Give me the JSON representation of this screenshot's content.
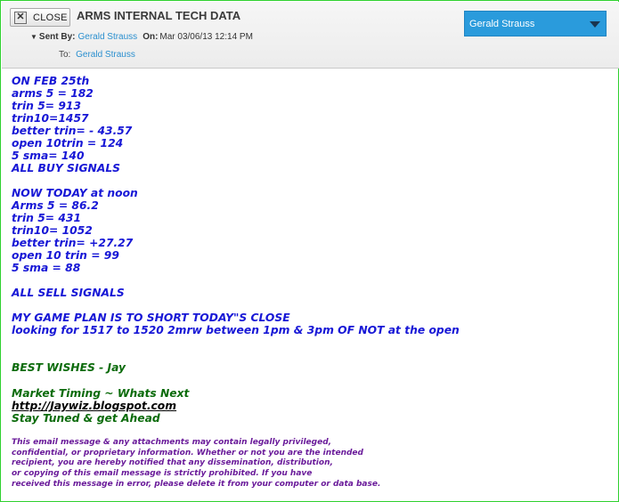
{
  "header": {
    "close_label": "CLOSE",
    "subject": "ARMS INTERNAL TECH DATA",
    "user_menu": "Gerald Strauss",
    "sent_by_label": "Sent By:",
    "sender": "Gerald Strauss",
    "on_label": "On:",
    "date": "Mar 03/06/13 12:14 PM",
    "to_label": "To:",
    "recipient": "Gerald Strauss"
  },
  "message": {
    "feb_block": [
      "ON FEB 25th",
      "arms 5 = 182",
      "trin 5= 913",
      "trin10=1457",
      "better trin= - 43.57",
      "open 10trin = 124",
      "5 sma= 140",
      "ALL BUY SIGNALS"
    ],
    "today_block": [
      "NOW TODAY at noon",
      "Arms 5 = 86.2",
      "trin 5= 431",
      "trin10= 1052",
      "better trin= +27.27",
      "open 10 trin = 99",
      "5 sma = 88"
    ],
    "sell_signals": "ALL SELL SIGNALS",
    "plan_line1": "MY GAME PLAN IS TO SHORT TODAY\"S CLOSE",
    "plan_line2": "looking for 1517 to 1520 2mrw between 1pm & 3pm OF NOT at the open",
    "wishes": "BEST WISHES - Jay",
    "market_timing": "Market Timing ~ Whats Next",
    "link": "http://Jaywiz.blogspot.com",
    "stay_tuned": "Stay Tuned & get Ahead",
    "disclaimer": [
      "This email message & any attachments may contain legally privileged,",
      "confidential, or proprietary information. Whether or not you are the intended",
      "recipient, you are hereby notified that any dissemination, distribution,",
      "or copying of this email message is strictly prohibited. If you have",
      "received this message in error, please delete it from your computer or data base."
    ]
  },
  "colors": {
    "frame_border": "#2fd12f",
    "user_menu_bg": "#2a9bdc",
    "sender_link": "#2a8fcf",
    "body_blue": "#1717d6",
    "body_green": "#0b6b0b",
    "disclaimer_purple": "#6a1b9a"
  },
  "icons": {
    "close": "close-x-icon",
    "user_menu": "chevron-down-icon",
    "sent_by_toggle": "caret-down-icon"
  }
}
